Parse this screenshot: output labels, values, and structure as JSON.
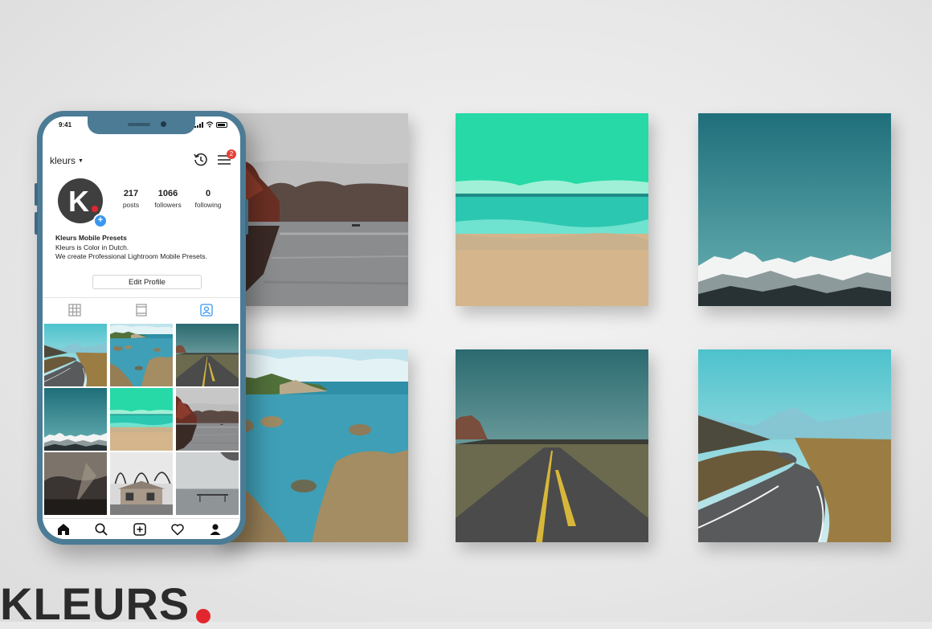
{
  "phone": {
    "status_time": "9:41",
    "username": "kleurs",
    "notification_count": "2",
    "avatar_letter": "K",
    "stats": [
      {
        "num": "217",
        "label": "posts"
      },
      {
        "num": "1066",
        "label": "followers"
      },
      {
        "num": "0",
        "label": "following"
      }
    ],
    "bio": {
      "name": "Kleurs Mobile Presets",
      "line1": "Kleurs is Color in Dutch.",
      "line2": "We create Professional Lightroom Mobile Presets."
    },
    "edit_profile_label": "Edit Profile",
    "tabs": [
      "grid-icon",
      "feed-icon",
      "tagged-icon"
    ],
    "bottom_nav": [
      "home-icon",
      "search-icon",
      "add-post-icon",
      "heart-icon",
      "profile-icon"
    ]
  },
  "brand": {
    "text": "KLEURS",
    "dot_color": "#e3262d"
  },
  "colors": {
    "phone_frame": "#4c7b95",
    "accent_blue": "#3897f0",
    "notification_red": "#e8413a"
  },
  "photos": [
    "lake-photo",
    "beach-photo",
    "mountains-photo",
    "coast-photo",
    "road-straight-photo",
    "road-curve-photo"
  ]
}
